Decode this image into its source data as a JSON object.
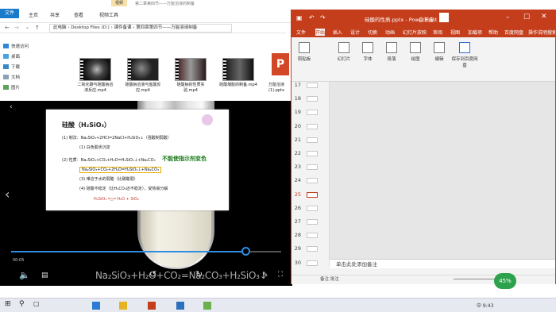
{
  "explorer": {
    "ctx_tab": "视频",
    "title": "第二章第四节——万能溶液的制备",
    "tabs": [
      "文件",
      "主页",
      "共享",
      "查看",
      "视频工具"
    ],
    "address": "此电脑 › Desktop Files (D:) › 课件备课 › 第四章第四节——万能溶液制备",
    "nav": [
      "快速访问",
      "桌面",
      "下载",
      "文档",
      "图片"
    ],
    "files": [
      {
        "label": "二氧化碳与硅酸钠溶液反应.mp4"
      },
      {
        "label": "硅酸钠溶液与盐酸反应.mp4"
      },
      {
        "label": "硅酸钠的性质实验.mp4"
      },
      {
        "label": "硅酸凝胶的制备.mp4"
      },
      {
        "label": "万能溶液(1).pptx"
      }
    ],
    "ppt_file_glyph": "P"
  },
  "player": {
    "time": "00:05",
    "formula": "Na₂SiO₃+H₂O+CO₂=Na₂CO₃+H₂SiO₃↓",
    "progress": 0.87
  },
  "ppt": {
    "title": "硅酸的性质.pptx - PowerPoint",
    "user": "白羊座",
    "tabs": [
      "文件",
      "开始",
      "插入",
      "设计",
      "切换",
      "动画",
      "幻灯片放映",
      "审阅",
      "视图",
      "加载项",
      "帮助",
      "百度网盘",
      "操作说明搜索"
    ],
    "active_tab": "开始",
    "ribbon": [
      "剪贴板",
      "幻灯片",
      "字体",
      "段落",
      "绘图",
      "编辑",
      "保存到百度网盘"
    ],
    "slide_numbers": [
      17,
      18,
      19,
      20,
      21,
      22,
      23,
      24,
      25,
      26,
      27,
      28,
      29,
      30
    ],
    "active_slide": 25,
    "slide": {
      "heading": "硅酸（H₂SiO₃）",
      "line1": "(1) 制法：Na₂SiO₃+2HCl=2NaCl+H₂SiO₃↓（强酸制弱酸）",
      "line1b": "(1) 白色胶状沉淀",
      "line2": "(2) 性质：Na₂SiO₃+CO₂+H₂O=H₂SiO₃↓+Na₂CO₃",
      "highlight": "不能使指示剂变色",
      "line3": "Na₂SiO₃+CO₂+2H₂O=H₂SiO₃↓+Na₂CO₃",
      "line4": "(3) 难溶于水的弱酸（比碳酸弱）",
      "line5": "(4) 硅酸不稳定（比H₂CO₃还不稳定），受热易分解",
      "line6": "H₂SiO₃ ═△═ H₂O + SiO₂"
    },
    "notes": "单击此处添加备注",
    "status": "备注    批注",
    "net": "45%"
  },
  "taskbar": {
    "tray": "中  9:43"
  }
}
